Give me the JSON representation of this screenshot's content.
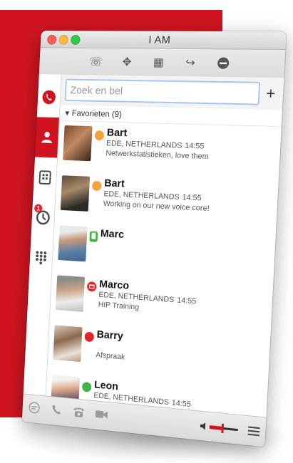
{
  "window": {
    "title": "I AM"
  },
  "toolbar": {
    "buttons": [
      {
        "name": "call-options-button",
        "icon": "phone-settings-icon",
        "glyph": "☏"
      },
      {
        "name": "transfer-button",
        "icon": "move-arrows-icon",
        "glyph": "✥"
      },
      {
        "name": "add-building-button",
        "icon": "building-add-icon",
        "glyph": "▦"
      },
      {
        "name": "forward-call-button",
        "icon": "phone-forward-icon",
        "glyph": "↪"
      },
      {
        "name": "do-not-disturb-button",
        "icon": "minus-circle-icon",
        "glyph": "⊖"
      }
    ]
  },
  "sidebar": {
    "items": [
      {
        "name": "sidebar-item-phone",
        "icon": "phone-icon",
        "active": false
      },
      {
        "name": "sidebar-item-contacts",
        "icon": "person-icon",
        "active": true
      },
      {
        "name": "sidebar-item-company",
        "icon": "building-icon",
        "active": false
      },
      {
        "name": "sidebar-item-history",
        "icon": "clock-icon",
        "active": false,
        "badge": "1"
      },
      {
        "name": "sidebar-item-dialpad",
        "icon": "dialpad-icon",
        "active": false
      }
    ]
  },
  "search": {
    "placeholder": "Zoek en bel"
  },
  "add_label": "+",
  "group": {
    "label": "Favorieten (9)",
    "arrow": "▾"
  },
  "contacts": [
    {
      "name": "Bart",
      "status": "orange",
      "location": "EDE, NETHERLANDS",
      "time": "14:55",
      "message": "Netwerkstatistieken, love them"
    },
    {
      "name": "Bart",
      "status": "orange",
      "location": "EDE, NETHERLANDS",
      "time": "14:55",
      "message": "Working on our new voice core!"
    },
    {
      "name": "Marc",
      "status": "mobile",
      "location": "",
      "time": "",
      "message": ""
    },
    {
      "name": "Marco",
      "status": "calendar",
      "location": "EDE, NETHERLANDS",
      "time": "14:55",
      "message": "HIP Training"
    },
    {
      "name": "Barry",
      "status": "red",
      "location": "",
      "time": "",
      "message": "Afspraak"
    },
    {
      "name": "Leon",
      "status": "green",
      "location": "EDE, NETHERLANDS",
      "time": "14:55",
      "message": ""
    }
  ],
  "bottombar": {
    "icons": [
      "chat-icon",
      "phone-icon",
      "desk-phone-icon",
      "video-icon"
    ],
    "volume_level": 0.45
  },
  "colors": {
    "accent": "#d0141f",
    "available": "#3fb64a",
    "away": "#f4a23c",
    "busy": "#e4222c"
  }
}
